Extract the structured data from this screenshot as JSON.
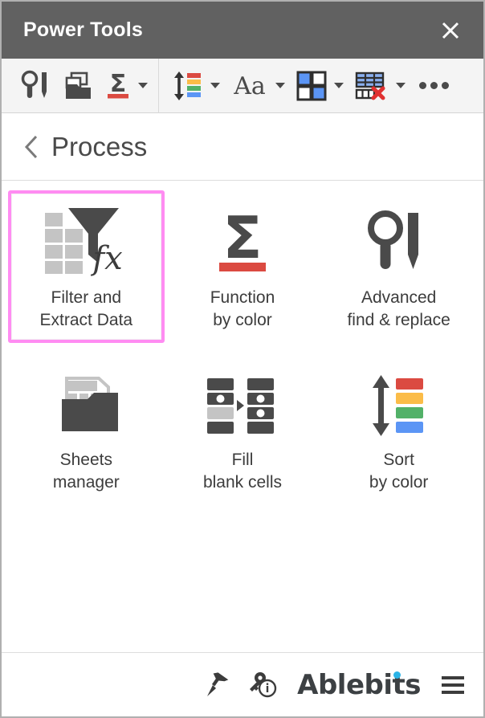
{
  "window": {
    "title": "Power Tools",
    "close_icon": "close-icon"
  },
  "toolbar": {
    "buttons": [
      {
        "name": "advanced-find-replace",
        "icon": "magnifier-pencil-icon",
        "has_caret": false
      },
      {
        "name": "sheets-manager",
        "icon": "folder-sheets-icon",
        "has_caret": false
      },
      {
        "name": "function-by-color",
        "icon": "sigma-red-underline-icon",
        "has_caret": true
      },
      {
        "name": "sort-by-color",
        "icon": "arrows-color-bars-icon",
        "has_caret": true
      },
      {
        "name": "text-tools",
        "icon": "aa-text-icon",
        "has_caret": true
      },
      {
        "name": "randomize",
        "icon": "four-squares-icon",
        "has_caret": true
      },
      {
        "name": "clear-table",
        "icon": "table-clear-icon",
        "has_caret": true
      },
      {
        "name": "more-tools",
        "icon": "ellipsis-icon",
        "has_caret": false
      }
    ],
    "more_label": "•••"
  },
  "breadcrumb": {
    "back_icon": "chevron-left-icon",
    "label": "Process"
  },
  "tools": [
    {
      "id": "filter-and-extract-data",
      "icon": "funnel-fx-icon",
      "label_lines": [
        "Filter and",
        "Extract Data"
      ],
      "selected": true
    },
    {
      "id": "function-by-color",
      "icon": "sigma-red-underline-icon",
      "label_lines": [
        "Function",
        "by color"
      ],
      "selected": false
    },
    {
      "id": "advanced-find-replace",
      "icon": "magnifier-pencil-icon",
      "label_lines": [
        "Advanced",
        "find & replace"
      ],
      "selected": false
    },
    {
      "id": "sheets-manager",
      "icon": "folder-sheets-icon",
      "label_lines": [
        "Sheets",
        "manager"
      ],
      "selected": false
    },
    {
      "id": "fill-blank-cells",
      "icon": "fill-blank-cells-icon",
      "label_lines": [
        "Fill",
        "blank cells"
      ],
      "selected": false
    },
    {
      "id": "sort-by-color",
      "icon": "arrows-color-bars-icon",
      "label_lines": [
        "Sort",
        "by color"
      ],
      "selected": false
    }
  ],
  "footer": {
    "pin_icon": "pin-icon",
    "license_icon": "key-info-icon",
    "brand": "Ablebits",
    "menu_icon": "hamburger-menu-icon"
  },
  "colors": {
    "titlebar_bg": "#616161",
    "toolbar_bg": "#f4f4f4",
    "selection_border": "#ff8cf2",
    "icon_dark": "#4a4a4a",
    "icon_light": "#c4c4c4",
    "accent_red": "#db4a41",
    "accent_yellow": "#fbbc48",
    "accent_green": "#52b168",
    "accent_blue": "#5b95f5",
    "brand_dot": "#2bb3e6",
    "text": "#3c3c3c"
  }
}
